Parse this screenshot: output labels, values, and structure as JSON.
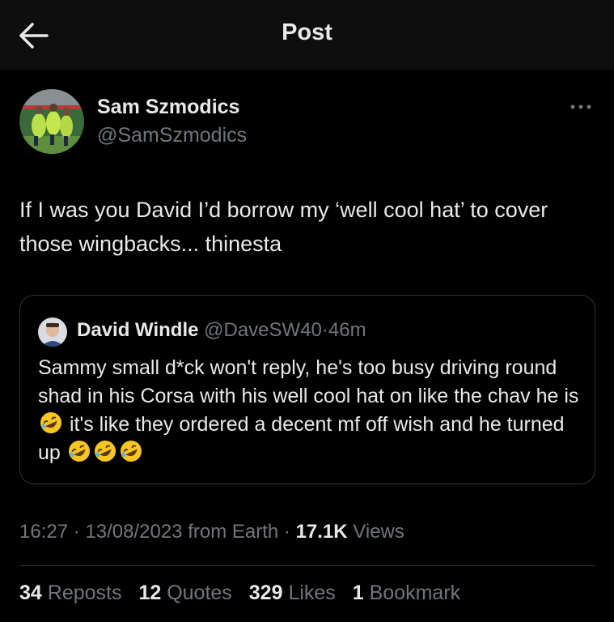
{
  "header": {
    "title": "Post"
  },
  "author": {
    "name": "Sam Szmodics",
    "handle": "@SamSzmodics"
  },
  "post": {
    "text": "If I was you David I’d borrow my ‘well cool hat’ to cover those wingbacks... thinesta"
  },
  "quoted": {
    "name": "David Windle",
    "handle": "@DaveSW40",
    "separator": "·",
    "time": "46m",
    "text_1": "Sammy small d*ck won't reply, he's too busy driving round shad in his Corsa with his well cool hat on like the chav he is",
    "text_2": "it's like they ordered a decent mf off wish and he turned up"
  },
  "meta": {
    "time": "16:27",
    "sep1": "·",
    "date": "13/08/2023",
    "source": "from Earth",
    "sep2": "·",
    "views_count": "17.1K",
    "views_label": "Views"
  },
  "stats": {
    "reposts_count": "34",
    "reposts_label": "Reposts",
    "quotes_count": "12",
    "quotes_label": "Quotes",
    "likes_count": "329",
    "likes_label": "Likes",
    "bookmarks_count": "1",
    "bookmarks_label": "Bookmark"
  },
  "icons": {
    "back": "arrow-left-icon",
    "more": "more-horizontal-icon",
    "emoji": "rolling-on-floor-laughing"
  },
  "colors": {
    "background": "#000000",
    "text": "#e7e9ea",
    "secondary": "#71767b",
    "border": "#2f3336"
  }
}
